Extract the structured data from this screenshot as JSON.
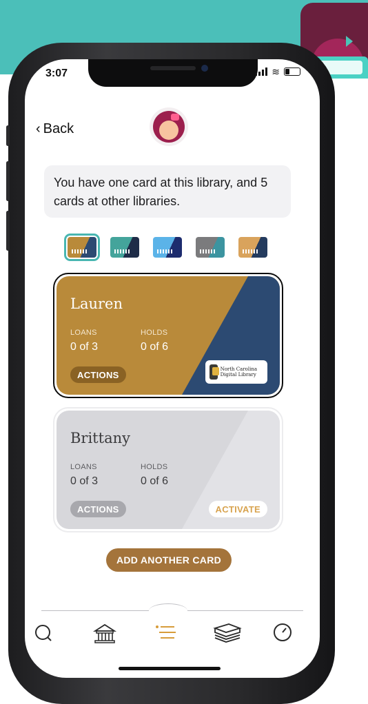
{
  "status_bar": {
    "time": "3:07"
  },
  "nav": {
    "back_label": "Back"
  },
  "info": {
    "message": "You have one card at this library, and 5 cards at other libraries."
  },
  "thumbnails": [
    {
      "name": "card-thumb-1",
      "selected": true,
      "colors": [
        "#b98a3a",
        "#2c4a72"
      ]
    },
    {
      "name": "card-thumb-2",
      "selected": false,
      "colors": [
        "#44a49b",
        "#1e2c48"
      ]
    },
    {
      "name": "card-thumb-3",
      "selected": false,
      "colors": [
        "#5bb3e8",
        "#1d2c6e"
      ]
    },
    {
      "name": "card-thumb-4",
      "selected": false,
      "colors": [
        "#7b7b7d",
        "#3c94a0"
      ]
    },
    {
      "name": "card-thumb-5",
      "selected": false,
      "colors": [
        "#d9a35c",
        "#243b5e"
      ]
    }
  ],
  "cards": [
    {
      "name": "Lauren",
      "loans_label": "LOANS",
      "loans_value": "0 of 3",
      "holds_label": "HOLDS",
      "holds_value": "0 of 6",
      "actions_label": "ACTIONS",
      "library_badge": "North Carolina Digital Library",
      "colors": {
        "primary": "#b98a3a",
        "secondary": "#2c4a72"
      }
    },
    {
      "name": "Brittany",
      "loans_label": "LOANS",
      "loans_value": "0 of 3",
      "holds_label": "HOLDS",
      "holds_value": "0 of 6",
      "actions_label": "ACTIONS",
      "activate_label": "ACTIVATE",
      "colors": {
        "primary": "#d7d7db",
        "secondary": "#e2e2e6"
      }
    }
  ],
  "add_card": {
    "label": "ADD ANOTHER CARD"
  },
  "tabs": [
    {
      "name": "search-icon"
    },
    {
      "name": "library-icon"
    },
    {
      "name": "menu-icon",
      "active": true
    },
    {
      "name": "shelf-icon"
    },
    {
      "name": "timeline-icon"
    }
  ],
  "colors": {
    "accent_teal": "#4bbfb9",
    "brand_maroon": "#6a1f3d",
    "add_button": "#a4743b",
    "menu_active": "#d79c3a"
  }
}
